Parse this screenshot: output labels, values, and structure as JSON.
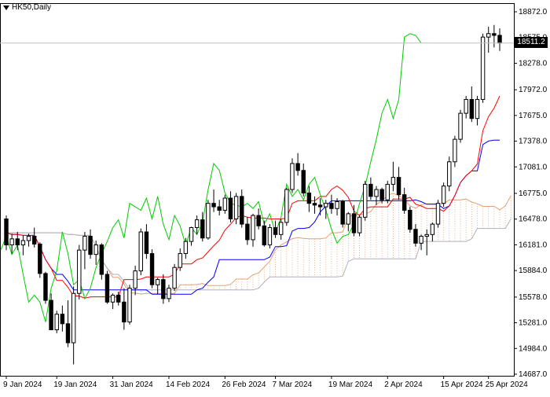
{
  "header": {
    "symbol": "HK50,Daily",
    "current_price_label": "18511.2"
  },
  "colors": {
    "tenkan": "#ff0000",
    "kijun": "#0000ff",
    "chikou": "#00cc00",
    "cloud_up": "#e8a070",
    "cloud_down": "#b0b0c0",
    "candle_bull": "#ffffff",
    "candle_bear": "#000000"
  },
  "chart_data": {
    "type": "candlestick",
    "title": "HK50,Daily",
    "y_ticks": [
      "18872.0",
      "18575.0",
      "18278.0",
      "17972.0",
      "17675.0",
      "17378.0",
      "17081.0",
      "16775.0",
      "16478.0",
      "16181.0",
      "15884.0",
      "15578.0",
      "15281.0",
      "14984.0",
      "14687.0"
    ],
    "x_ticks": [
      "9 Jan 2024",
      "19 Jan 2024",
      "31 Jan 2024",
      "14 Feb 2024",
      "26 Feb 2024",
      "7 Mar 2024",
      "19 Mar 2024",
      "2 Apr 2024",
      "15 Apr 2024",
      "25 Apr 2024"
    ],
    "ylim": [
      14687,
      18872
    ],
    "last_price": 18511.2,
    "candles": [
      [
        16480,
        16520,
        16120,
        16180
      ],
      [
        16180,
        16310,
        16080,
        16250
      ],
      [
        16250,
        16330,
        16120,
        16180
      ],
      [
        16180,
        16290,
        16060,
        16230
      ],
      [
        16230,
        16310,
        16160,
        16280
      ],
      [
        16280,
        16380,
        16150,
        16190
      ],
      [
        16190,
        16210,
        15800,
        15850
      ],
      [
        15850,
        15870,
        15500,
        15540
      ],
      [
        15540,
        15620,
        15300,
        15200
      ],
      [
        15200,
        15420,
        15160,
        15380
      ],
      [
        15380,
        15480,
        15180,
        15270
      ],
      [
        15270,
        15540,
        15000,
        15050
      ],
      [
        15050,
        15700,
        14800,
        15620
      ],
      [
        15620,
        16180,
        15550,
        16120
      ],
      [
        16120,
        16330,
        15900,
        16280
      ],
      [
        16280,
        16360,
        16020,
        16070
      ],
      [
        16070,
        16230,
        15950,
        16180
      ],
      [
        16180,
        16200,
        15780,
        15840
      ],
      [
        15840,
        15880,
        15500,
        15520
      ],
      [
        15520,
        15620,
        15440,
        15600
      ],
      [
        15600,
        15640,
        15480,
        15520
      ],
      [
        15520,
        15680,
        15200,
        15290
      ],
      [
        15290,
        15720,
        15260,
        15680
      ],
      [
        15680,
        15940,
        15600,
        15880
      ],
      [
        15880,
        16370,
        15830,
        16330
      ],
      [
        16330,
        16420,
        16020,
        16080
      ],
      [
        16080,
        16130,
        15680,
        15720
      ],
      [
        15720,
        15800,
        15610,
        15780
      ],
      [
        15780,
        15840,
        15500,
        15560
      ],
      [
        15560,
        15720,
        15520,
        15680
      ],
      [
        15680,
        15960,
        15650,
        15920
      ],
      [
        15920,
        16140,
        15880,
        16080
      ],
      [
        16080,
        16260,
        16020,
        16220
      ],
      [
        16220,
        16390,
        16170,
        16380
      ],
      [
        16380,
        16520,
        16300,
        16470
      ],
      [
        16470,
        16560,
        16220,
        16260
      ],
      [
        16260,
        16700,
        16240,
        16660
      ],
      [
        16660,
        16820,
        16560,
        16620
      ],
      [
        16620,
        16700,
        16520,
        16580
      ],
      [
        16580,
        16760,
        16540,
        16720
      ],
      [
        16720,
        16800,
        16440,
        16480
      ],
      [
        16480,
        16780,
        16420,
        16740
      ],
      [
        16740,
        16820,
        16380,
        16420
      ],
      [
        16420,
        16500,
        16180,
        16240
      ],
      [
        16240,
        16540,
        16160,
        16520
      ],
      [
        16520,
        16600,
        16360,
        16400
      ],
      [
        16400,
        16460,
        16160,
        16180
      ],
      [
        16180,
        16420,
        16140,
        16380
      ],
      [
        16380,
        16460,
        16260,
        16300
      ],
      [
        16300,
        16480,
        16240,
        16440
      ],
      [
        16440,
        16840,
        16400,
        16820
      ],
      [
        16820,
        17180,
        16780,
        17120
      ],
      [
        17120,
        17240,
        16980,
        17040
      ],
      [
        17040,
        17120,
        16740,
        16780
      ],
      [
        16780,
        16860,
        16560,
        16660
      ],
      [
        16660,
        16740,
        16540,
        16640
      ],
      [
        16640,
        16720,
        16520,
        16620
      ],
      [
        16620,
        16700,
        16480,
        16660
      ],
      [
        16660,
        16760,
        16540,
        16600
      ],
      [
        16600,
        16720,
        16520,
        16680
      ],
      [
        16680,
        16700,
        16380,
        16420
      ],
      [
        16420,
        16560,
        16340,
        16540
      ],
      [
        16540,
        16640,
        16280,
        16320
      ],
      [
        16320,
        16520,
        16280,
        16500
      ],
      [
        16500,
        16920,
        16460,
        16880
      ],
      [
        16880,
        16960,
        16700,
        16740
      ],
      [
        16740,
        16860,
        16640,
        16820
      ],
      [
        16820,
        16840,
        16660,
        16700
      ],
      [
        16700,
        16920,
        16660,
        16880
      ],
      [
        16880,
        17140,
        16800,
        16960
      ],
      [
        16960,
        17080,
        16700,
        16760
      ],
      [
        16760,
        16840,
        16540,
        16580
      ],
      [
        16580,
        16620,
        16320,
        16360
      ],
      [
        16360,
        16420,
        16160,
        16200
      ],
      [
        16200,
        16300,
        16120,
        16280
      ],
      [
        16280,
        16360,
        16060,
        16300
      ],
      [
        16300,
        16440,
        16220,
        16420
      ],
      [
        16420,
        16700,
        16380,
        16660
      ],
      [
        16660,
        16900,
        16620,
        16860
      ],
      [
        16860,
        17200,
        16800,
        17140
      ],
      [
        17140,
        17440,
        17080,
        17400
      ],
      [
        17400,
        17740,
        17360,
        17700
      ],
      [
        17700,
        17900,
        17640,
        17860
      ],
      [
        17860,
        18010,
        17600,
        17640
      ],
      [
        17640,
        17900,
        17560,
        17860
      ],
      [
        17860,
        18620,
        17820,
        18580
      ],
      [
        18580,
        18700,
        18400,
        18620
      ],
      [
        18620,
        18720,
        18460,
        18600
      ],
      [
        18600,
        18680,
        18420,
        18511
      ]
    ]
  }
}
